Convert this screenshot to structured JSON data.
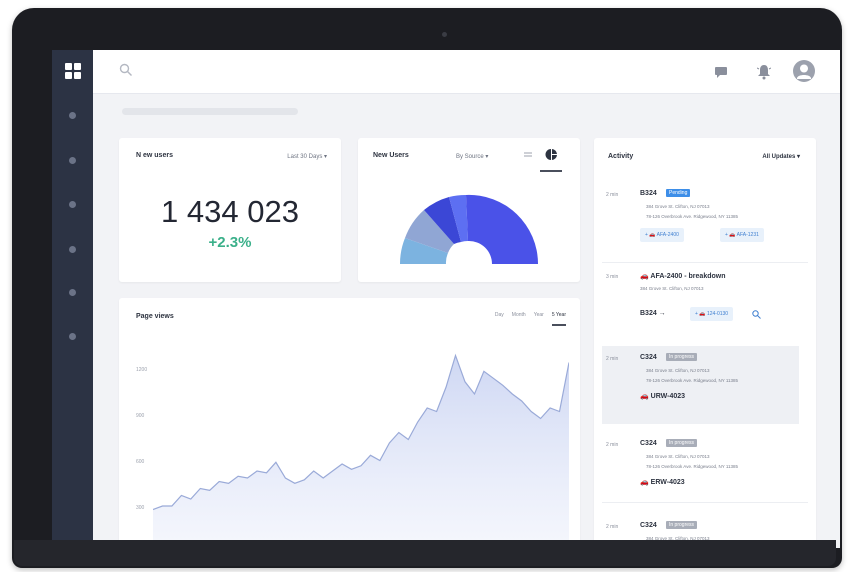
{
  "topbar": {
    "icons": [
      "search-icon",
      "chat-icon",
      "bell-icon",
      "avatar-icon"
    ]
  },
  "card_users": {
    "title": "N ew users",
    "period": "Last 30 Days ▾",
    "value": "1 434 023",
    "delta": "+2.3%"
  },
  "card_new_users": {
    "title": "New Users",
    "filter": "By Source ▾"
  },
  "card_pageviews": {
    "title": "Page views",
    "tabs": [
      "Day",
      "Month",
      "Year",
      "5 Year"
    ],
    "active_tab": "5 Year",
    "y_ticks": [
      "1200",
      "900",
      "600",
      "300"
    ]
  },
  "chart_data": {
    "type": "area",
    "series": [
      {
        "values": [
          22,
          24,
          24,
          30,
          28,
          34,
          33,
          38,
          37,
          41,
          40,
          44,
          43,
          49,
          40,
          37,
          39,
          44,
          40,
          44,
          48,
          45,
          47,
          53,
          50,
          60,
          66,
          62,
          72,
          80,
          78,
          92,
          110,
          95,
          88,
          101,
          97,
          93,
          88,
          84,
          78,
          74,
          80,
          78,
          106
        ]
      }
    ]
  },
  "activity": {
    "title": "Activity",
    "filter": "All Updates ▾",
    "items": [
      {
        "time": "2 min",
        "code": "B324",
        "badge": "Pending",
        "addr1": "384 Grove St. Clifton, NJ 07013",
        "addr2": "78-126 Overbrook Ave. Ridgewood, NY 11385",
        "chip1": "AFA-2400",
        "chip2": "AFA-1231"
      },
      {
        "time": "3 min",
        "title": "AFA-2400 - breakdown",
        "addr": "384 Grove St. Clifton, NJ 07013",
        "code": "B324",
        "chip": "124-0130"
      },
      {
        "time": "2 min",
        "code": "C324",
        "badge": "In progress",
        "addr1": "384 Grove St. Clifton, NJ 07013",
        "addr2": "78-126 Overbrook Ave. Ridgewood, NY 11385",
        "vehicle": "URW-4023"
      },
      {
        "time": "2 min",
        "code": "C324",
        "badge": "In progress",
        "addr1": "384 Grove St. Clifton, NJ 07013",
        "addr2": "78-126 Overbrook Ave. Ridgewood, NY 11385",
        "vehicle": "ERW-4023"
      },
      {
        "time": "2 min",
        "code": "C324",
        "badge": "In progress",
        "addr1": "384 Grove St. Clifton, NJ 07013"
      }
    ]
  },
  "colors": {
    "sidebar": "#2c3344",
    "accent_blue": "#4a52e8",
    "positive": "#3bb08a",
    "badge_blue": "#3d8ee8",
    "badge_gray": "#a8adb8"
  }
}
